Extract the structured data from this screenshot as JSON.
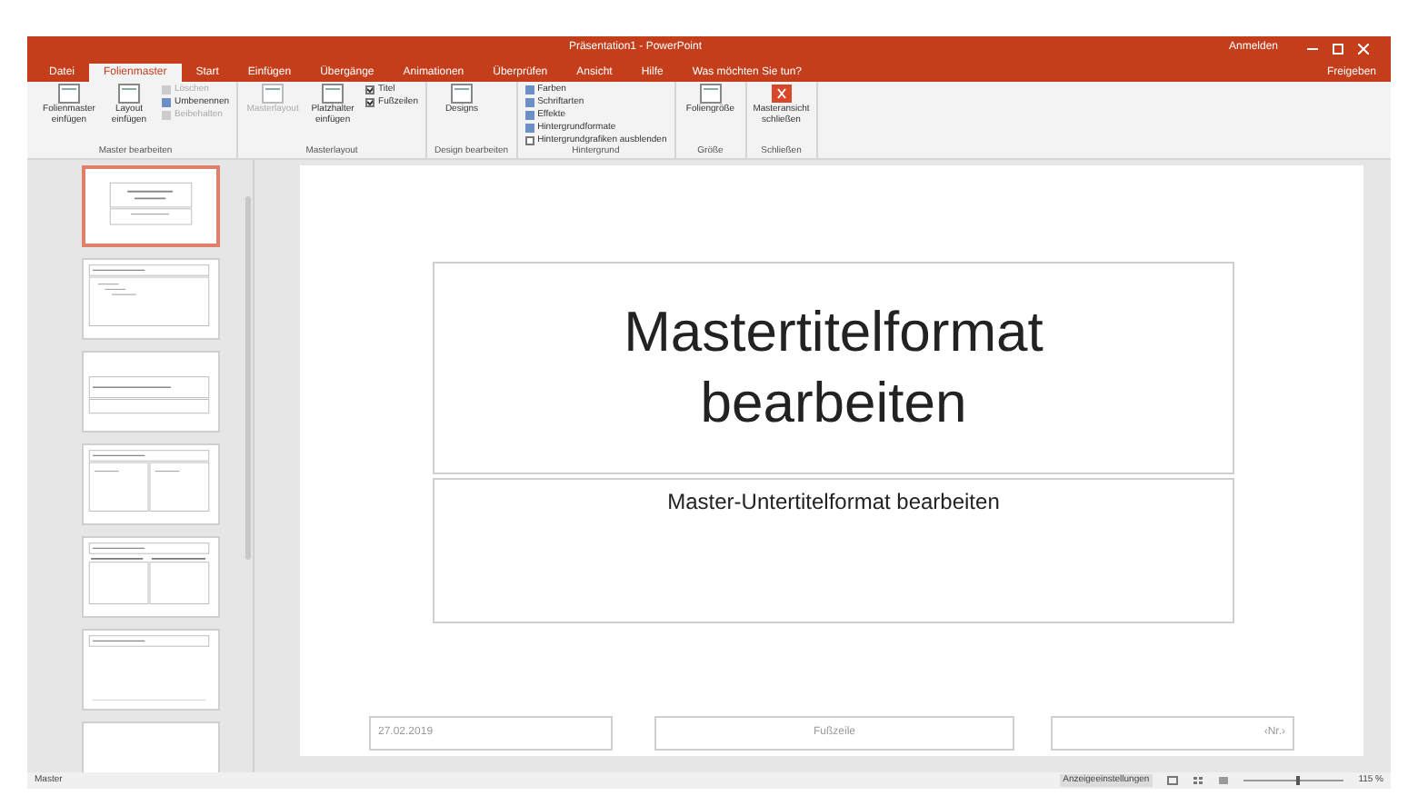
{
  "window": {
    "title": "Präsentation1 - PowerPoint",
    "user": "Anmelden",
    "share": "Freigeben"
  },
  "tabs": [
    {
      "label": "Datei",
      "selected": false
    },
    {
      "label": "Folienmaster",
      "selected": true
    },
    {
      "label": "Start",
      "selected": false
    },
    {
      "label": "Einfügen",
      "selected": false
    },
    {
      "label": "Übergänge",
      "selected": false
    },
    {
      "label": "Animationen",
      "selected": false
    },
    {
      "label": "Überprüfen",
      "selected": false
    },
    {
      "label": "Ansicht",
      "selected": false
    },
    {
      "label": "Hilfe",
      "selected": false
    }
  ],
  "tell_me": "Was möchten Sie tun?",
  "ribbon": {
    "groups": [
      {
        "label": "Master bearbeiten",
        "items": [
          {
            "kind": "large",
            "label": "Folienmaster einfügen",
            "disabled": false
          },
          {
            "kind": "large",
            "label": "Layout einfügen",
            "disabled": false
          },
          {
            "kind": "small",
            "label": "Löschen",
            "disabled": true
          },
          {
            "kind": "small",
            "label": "Umbenennen",
            "disabled": false
          },
          {
            "kind": "small",
            "label": "Beibehalten",
            "disabled": true
          }
        ]
      },
      {
        "label": "Masterlayout",
        "items": [
          {
            "kind": "large",
            "label": "Masterlayout",
            "disabled": true
          },
          {
            "kind": "large",
            "label": "Platzhalter einfügen",
            "disabled": false
          },
          {
            "kind": "check",
            "label": "Titel",
            "checked": true
          },
          {
            "kind": "check",
            "label": "Fußzeilen",
            "checked": true
          }
        ]
      },
      {
        "label": "Design bearbeiten",
        "items": [
          {
            "kind": "large",
            "label": "Designs",
            "disabled": false
          }
        ]
      },
      {
        "label": "Hintergrund",
        "items": [
          {
            "kind": "small",
            "label": "Farben",
            "disabled": false
          },
          {
            "kind": "small",
            "label": "Schriftarten",
            "disabled": false
          },
          {
            "kind": "small",
            "label": "Effekte",
            "disabled": false
          },
          {
            "kind": "small",
            "label": "Hintergrundformate",
            "disabled": false
          },
          {
            "kind": "check",
            "label": "Hintergrundgrafiken ausblenden",
            "checked": false
          }
        ]
      },
      {
        "label": "Größe",
        "items": [
          {
            "kind": "large",
            "label": "Foliengröße",
            "disabled": false
          }
        ]
      },
      {
        "label": "Schließen",
        "items": [
          {
            "kind": "close",
            "label": "Masteransicht schließen",
            "disabled": false
          }
        ]
      }
    ]
  },
  "thumbnails": [
    {
      "kind": "title",
      "selected": true
    },
    {
      "kind": "content",
      "selected": false
    },
    {
      "kind": "section",
      "selected": false
    },
    {
      "kind": "two",
      "selected": false
    },
    {
      "kind": "compare",
      "selected": false
    },
    {
      "kind": "titleonly",
      "selected": false
    },
    {
      "kind": "blank",
      "selected": false
    }
  ],
  "slide": {
    "title": "Mastertitelformat bearbeiten",
    "subtitle": "Master-Untertitelformat bearbeiten",
    "date": "27.02.2019",
    "footer": "Fußzeile",
    "number": "‹Nr.›"
  },
  "status_bar": {
    "view": "Master",
    "display_settings": "Anzeigeeinstellungen",
    "zoom": "115 %",
    "zoom_slider": {
      "level": 0.55
    }
  }
}
